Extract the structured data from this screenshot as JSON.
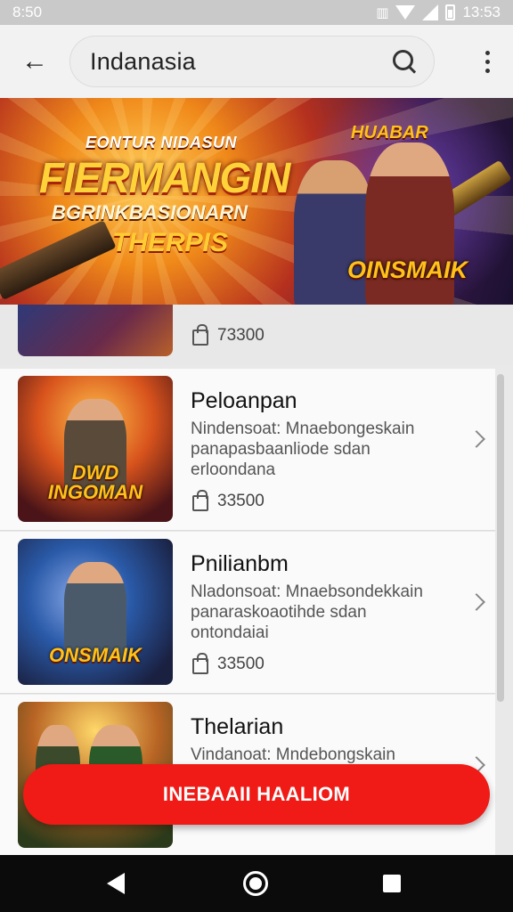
{
  "status_bar": {
    "time": "8:50",
    "clock": "13:53"
  },
  "search": {
    "query": "Indanasia"
  },
  "banner": {
    "top_line": "EONTUR NIDASUN",
    "title": "FIERMANGIN",
    "subtitle": "BGRINKBASIONARN",
    "tag": "THERPIS",
    "logo_top": "HUABAR",
    "logo_bottom": "OINSMAIK"
  },
  "peek_item": {
    "price": "73300"
  },
  "items": [
    {
      "title": "Peloanpan",
      "desc": "Nindensoat: Mnaebongeskain panapasbaanliode sdan erloondana",
      "price": "33500",
      "thumb_label": "DWD INGOMAN"
    },
    {
      "title": "Pnilianbm",
      "desc": "Nladonsoat: Mnaebsondekkain panaraskoaotihde sdan ontondaiai",
      "price": "33500",
      "thumb_label": "ONSMAIK"
    },
    {
      "title": "Thelarian",
      "desc": "Vindanoat: Mndebongskain",
      "price": "",
      "thumb_label": ""
    }
  ],
  "fab": {
    "label": "INEBAAII HAALIOM"
  },
  "colors": {
    "accent": "#f01a16",
    "nav_bg": "#0b0b0b"
  },
  "icons": [
    "back-arrow-icon",
    "search-icon",
    "more-vert-icon",
    "bag-icon",
    "chevron-right-icon",
    "nav-back-icon",
    "nav-home-icon",
    "nav-recent-icon"
  ]
}
